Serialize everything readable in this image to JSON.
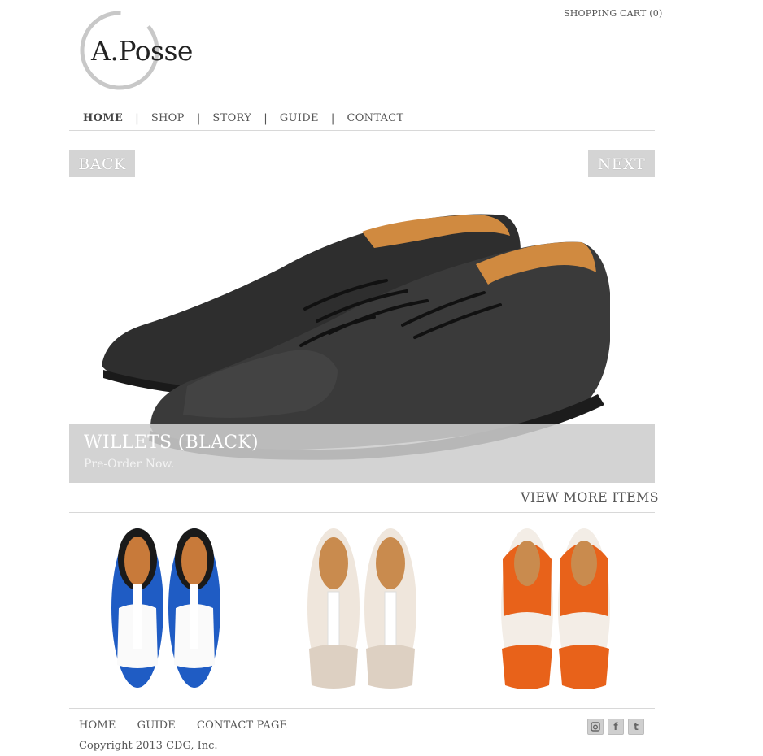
{
  "header": {
    "cart_label": "SHOPPING CART (0)",
    "logo_text": "A.Posse"
  },
  "nav": {
    "items": [
      {
        "label": "HOME",
        "active": true
      },
      {
        "label": "SHOP"
      },
      {
        "label": "STORY"
      },
      {
        "label": "GUIDE"
      },
      {
        "label": "CONTACT"
      }
    ],
    "separator": "|"
  },
  "slider": {
    "back_label": "BACK",
    "next_label": "NEXT",
    "title": "WILLETS (BLACK)",
    "subtitle": "Pre-Order Now."
  },
  "view_more_label": "VIEW MORE ITEMS",
  "products": [
    {
      "image": "blue-white-oxford-shoes"
    },
    {
      "image": "white-cream-sneaker-shoes"
    },
    {
      "image": "orange-white-oxford-shoes"
    }
  ],
  "footer": {
    "links": [
      "HOME",
      "GUIDE",
      "CONTACT PAGE"
    ],
    "copyright": "Copyright 2013 CDG, Inc.",
    "social": {
      "instagram": "instagram-icon",
      "facebook": "f",
      "twitter": "t"
    }
  },
  "colors": {
    "button_bg": "#d4d4d4",
    "caption_bg": "#cdcdcd",
    "accent_orange": "#e8621a",
    "accent_blue": "#1f5cc4"
  }
}
